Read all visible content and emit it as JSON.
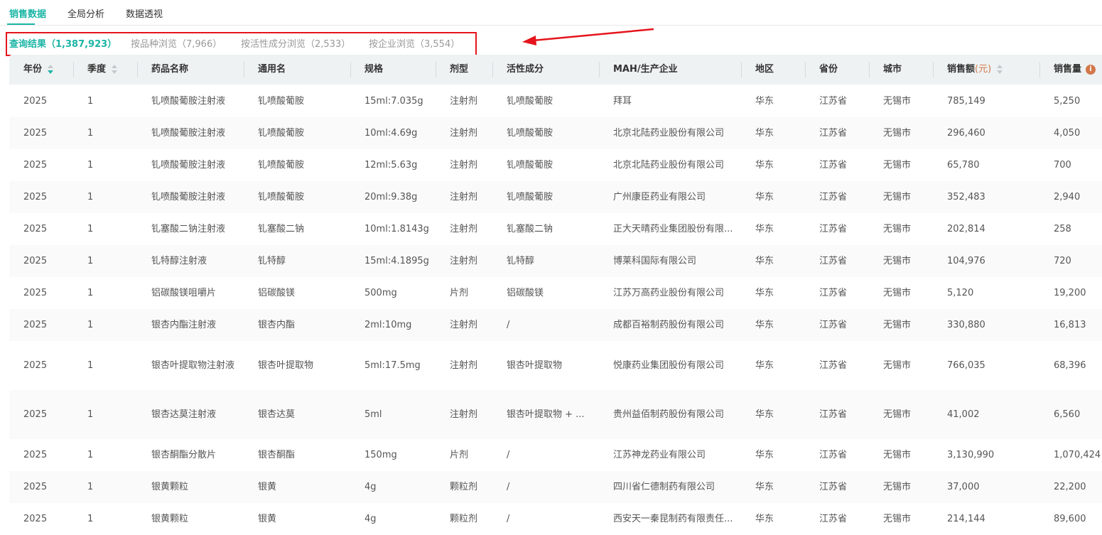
{
  "tabs": [
    "销售数据",
    "全局分析",
    "数据透视"
  ],
  "subtabs": [
    "查询结果（1,387,923）",
    "按品种浏览（7,966）",
    "按活性成分浏览（2,533）",
    "按企业浏览（3,554）"
  ],
  "columns": [
    "年份",
    "季度",
    "药品名称",
    "通用名",
    "规格",
    "剂型",
    "活性成分",
    "MAH/生产企业",
    "地区",
    "省份",
    "城市",
    "销售额",
    "销售量"
  ],
  "sales_unit": "(元)",
  "info_icon": "i",
  "colors": {
    "accent": "#1bb5a5",
    "highlight": "#e5141c",
    "unit": "#d2784a"
  },
  "rows": [
    [
      "2025",
      "1",
      "钆喷酸葡胺注射液",
      "钆喷酸葡胺",
      "15ml:7.035g",
      "注射剂",
      "钆喷酸葡胺",
      "拜耳",
      "华东",
      "江苏省",
      "无锡市",
      "785,149",
      "5,250"
    ],
    [
      "2025",
      "1",
      "钆喷酸葡胺注射液",
      "钆喷酸葡胺",
      "10ml:4.69g",
      "注射剂",
      "钆喷酸葡胺",
      "北京北陆药业股份有限公司",
      "华东",
      "江苏省",
      "无锡市",
      "296,460",
      "4,050"
    ],
    [
      "2025",
      "1",
      "钆喷酸葡胺注射液",
      "钆喷酸葡胺",
      "12ml:5.63g",
      "注射剂",
      "钆喷酸葡胺",
      "北京北陆药业股份有限公司",
      "华东",
      "江苏省",
      "无锡市",
      "65,780",
      "700"
    ],
    [
      "2025",
      "1",
      "钆喷酸葡胺注射液",
      "钆喷酸葡胺",
      "20ml:9.38g",
      "注射剂",
      "钆喷酸葡胺",
      "广州康臣药业有限公司",
      "华东",
      "江苏省",
      "无锡市",
      "352,483",
      "2,940"
    ],
    [
      "2025",
      "1",
      "钆塞酸二钠注射液",
      "钆塞酸二钠",
      "10ml:1.8143g",
      "注射剂",
      "钆塞酸二钠",
      "正大天晴药业集团股份有限...",
      "华东",
      "江苏省",
      "无锡市",
      "202,814",
      "258"
    ],
    [
      "2025",
      "1",
      "钆特醇注射液",
      "钆特醇",
      "15ml:4.1895g",
      "注射剂",
      "钆特醇",
      "博莱科国际有限公司",
      "华东",
      "江苏省",
      "无锡市",
      "104,976",
      "720"
    ],
    [
      "2025",
      "1",
      "铝碳酸镁咀嚼片",
      "铝碳酸镁",
      "500mg",
      "片剂",
      "铝碳酸镁",
      "江苏万高药业股份有限公司",
      "华东",
      "江苏省",
      "无锡市",
      "5,120",
      "19,200"
    ],
    [
      "2025",
      "1",
      "银杏内酯注射液",
      "银杏内酯",
      "2ml:10mg",
      "注射剂",
      "/",
      "成都百裕制药股份有限公司",
      "华东",
      "江苏省",
      "无锡市",
      "330,880",
      "16,813"
    ],
    [
      "2025",
      "1",
      "银杏叶提取物注射液",
      "银杏叶提取物",
      "5ml:17.5mg",
      "注射剂",
      "银杏叶提取物",
      "悦康药业集团股份有限公司",
      "华东",
      "江苏省",
      "无锡市",
      "766,035",
      "68,396"
    ],
    [
      "2025",
      "1",
      "银杏达莫注射液",
      "银杏达莫",
      "5ml",
      "注射剂",
      "银杏叶提取物 + ...",
      "贵州益佰制药股份有限公司",
      "华东",
      "江苏省",
      "无锡市",
      "41,002",
      "6,560"
    ],
    [
      "2025",
      "1",
      "银杏酮酯分散片",
      "银杏酮酯",
      "150mg",
      "片剂",
      "/",
      "江苏神龙药业有限公司",
      "华东",
      "江苏省",
      "无锡市",
      "3,130,990",
      "1,070,424"
    ],
    [
      "2025",
      "1",
      "银黄颗粒",
      "银黄",
      "4g",
      "颗粒剂",
      "/",
      "四川省仁德制药有限公司",
      "华东",
      "江苏省",
      "无锡市",
      "37,000",
      "22,200"
    ],
    [
      "2025",
      "1",
      "银黄颗粒",
      "银黄",
      "4g",
      "颗粒剂",
      "/",
      "西安天一秦昆制药有限责任...",
      "华东",
      "江苏省",
      "无锡市",
      "214,144",
      "89,600"
    ]
  ]
}
